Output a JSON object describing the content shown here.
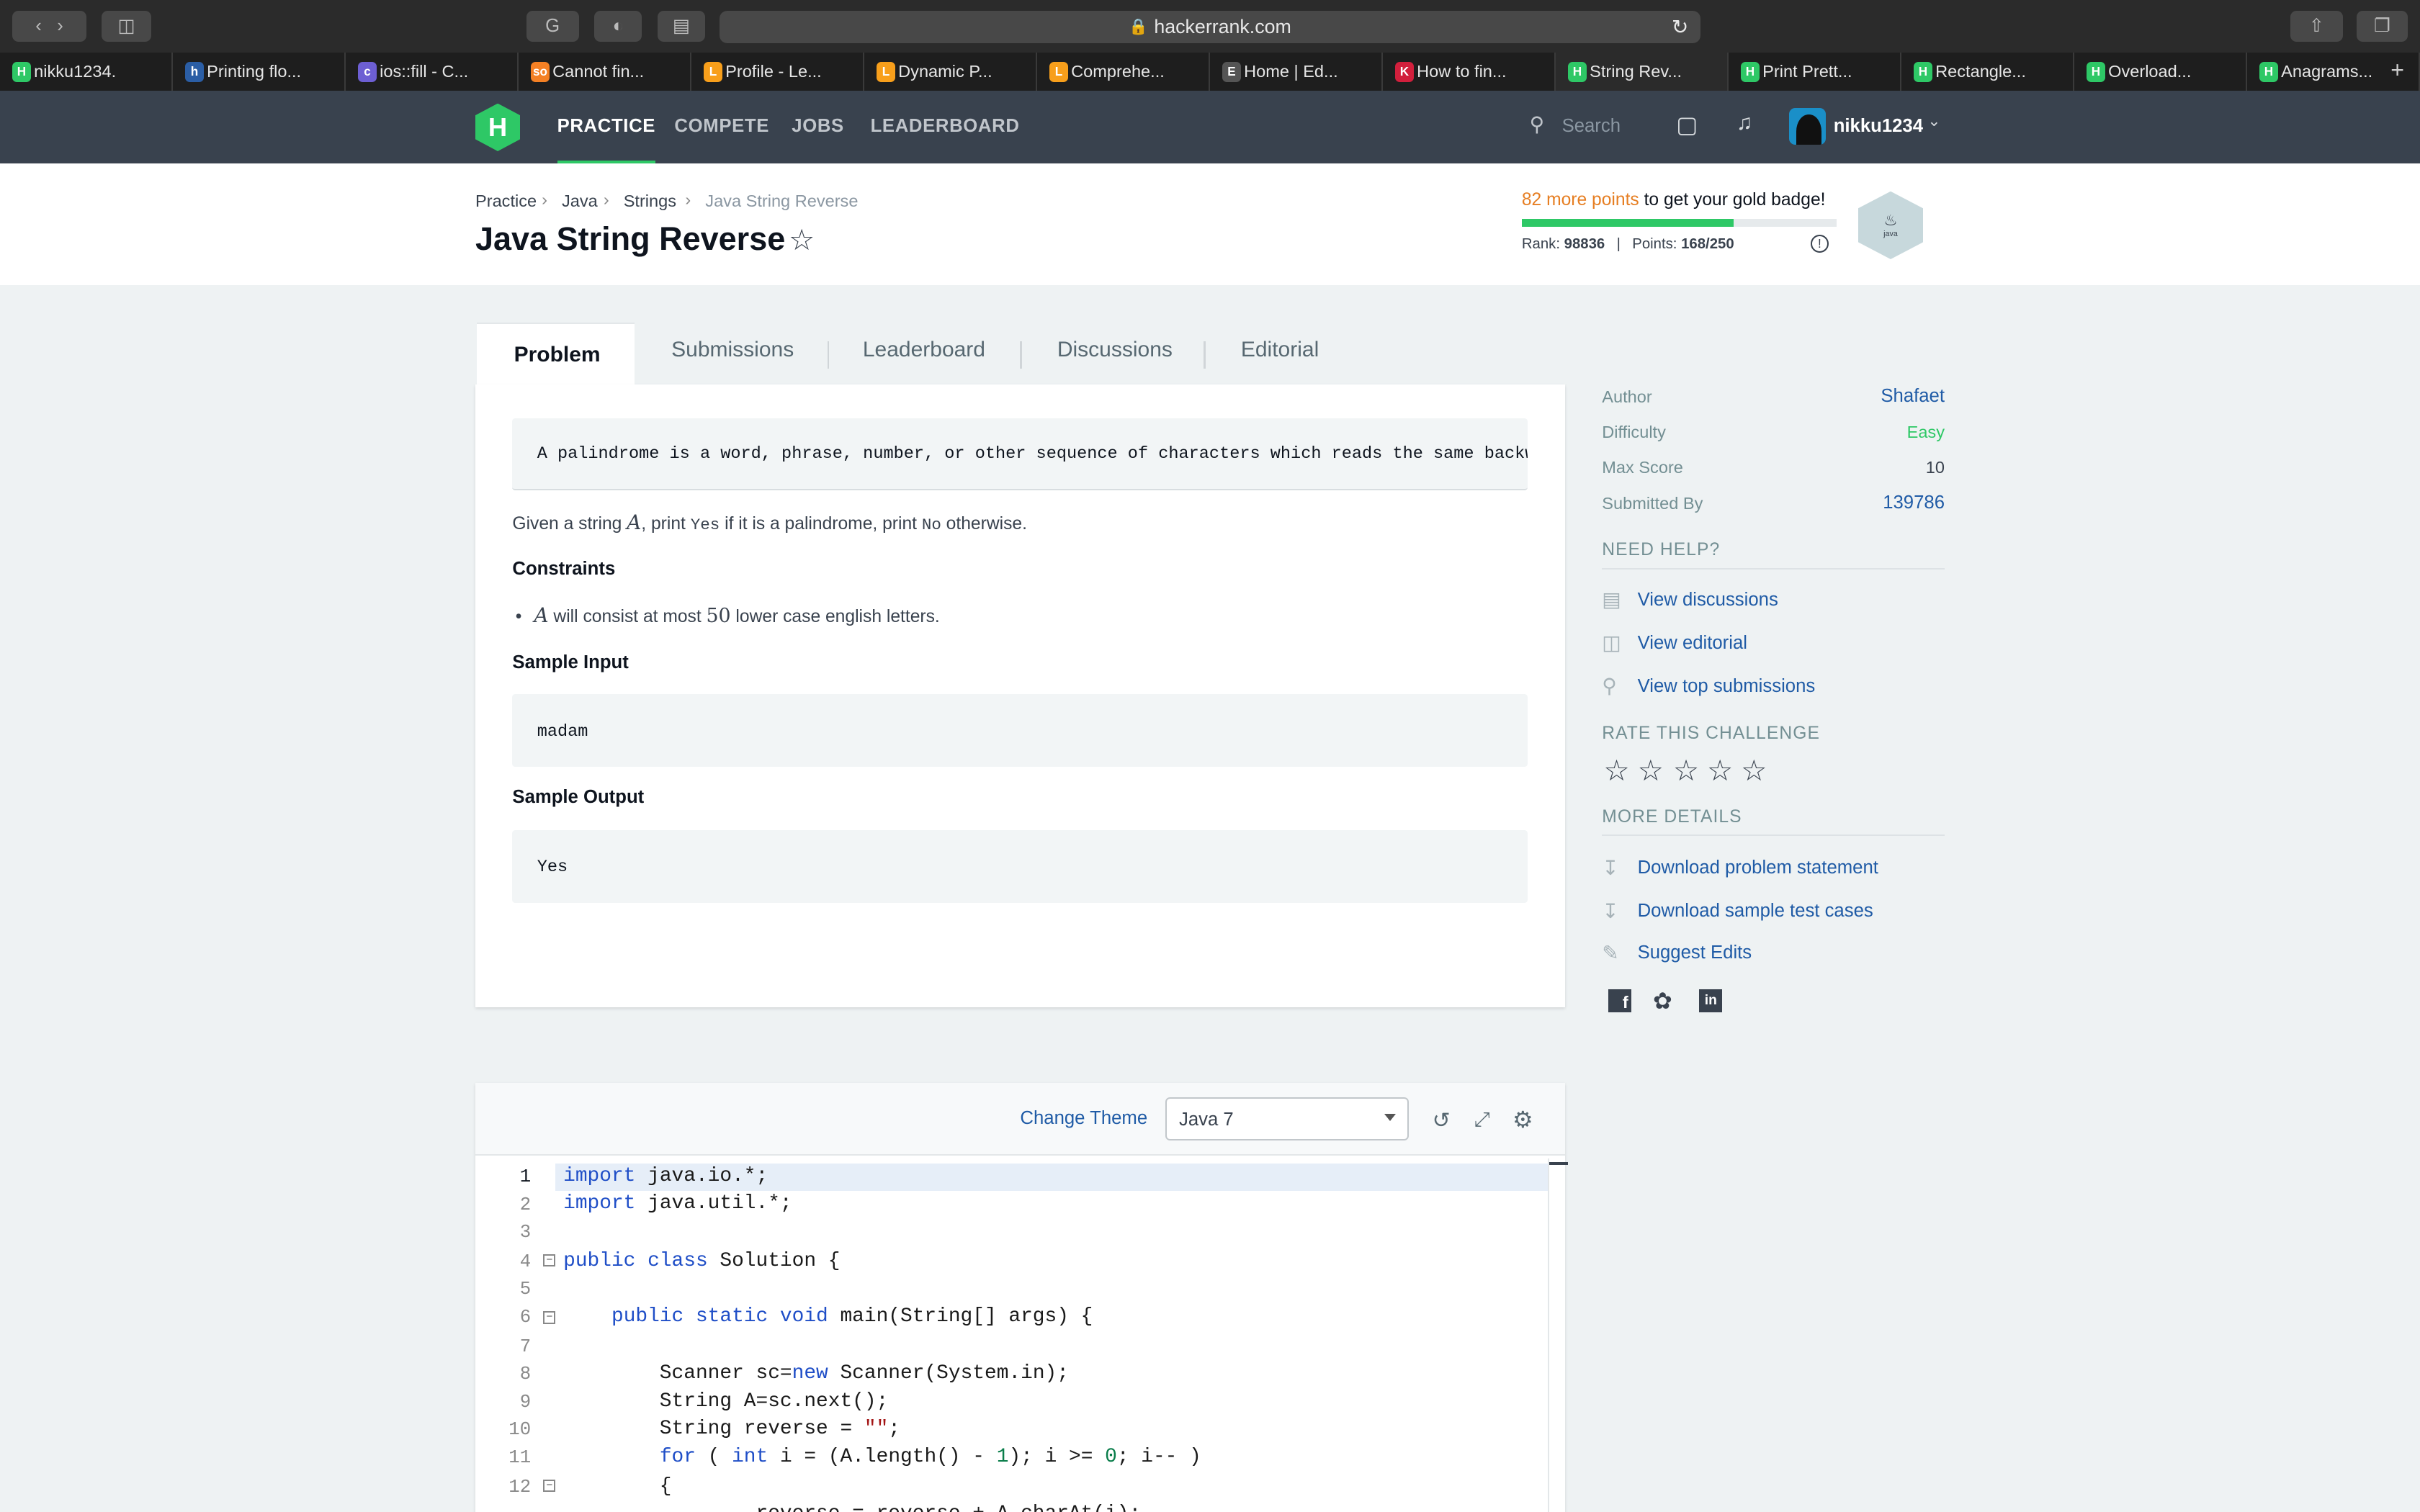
{
  "browser": {
    "url": "hackerrank.com",
    "tabs": [
      {
        "label": "nikku1234.",
        "favicon": "H",
        "color": "#2ec866"
      },
      {
        "label": "Printing flo...",
        "favicon": "h",
        "color": "#2b5ea5"
      },
      {
        "label": "ios::fill - C...",
        "favicon": "c",
        "color": "#6d5fd3"
      },
      {
        "label": "Cannot fin...",
        "favicon": "so",
        "color": "#f48024"
      },
      {
        "label": "Profile - Le...",
        "favicon": "L",
        "color": "#f89f1b"
      },
      {
        "label": "Dynamic P...",
        "favicon": "L",
        "color": "#f89f1b"
      },
      {
        "label": "Comprehe...",
        "favicon": "L",
        "color": "#f89f1b"
      },
      {
        "label": "Home | Ed...",
        "favicon": "E",
        "color": "#555555"
      },
      {
        "label": "How to fin...",
        "favicon": "K",
        "color": "#d21f3c"
      },
      {
        "label": "String Rev...",
        "favicon": "H",
        "color": "#2ec866",
        "active": true
      },
      {
        "label": "Print Prett...",
        "favicon": "H",
        "color": "#2ec866"
      },
      {
        "label": "Rectangle...",
        "favicon": "H",
        "color": "#2ec866"
      },
      {
        "label": "Overload...",
        "favicon": "H",
        "color": "#2ec866"
      },
      {
        "label": "Anagrams...",
        "favicon": "H",
        "color": "#2ec866"
      }
    ]
  },
  "nav": {
    "logo": "H",
    "links": [
      "PRACTICE",
      "COMPETE",
      "JOBS",
      "LEADERBOARD"
    ],
    "search_placeholder": "Search",
    "username": "nikku1234"
  },
  "breadcrumb": [
    "Practice",
    "Java",
    "Strings",
    "Java String Reverse"
  ],
  "page_title": "Java String Reverse",
  "badge": {
    "points_text": "82 more points",
    "suffix": " to get your gold badge!",
    "rank_label": "Rank:",
    "rank": "98836",
    "points_label": "Points:",
    "points": "168/250",
    "progress": 0.672,
    "badge_label": "java"
  },
  "problem_tabs": [
    "Problem",
    "Submissions",
    "Leaderboard",
    "Discussions",
    "Editorial"
  ],
  "problem": {
    "intro": "A palindrome is a word, phrase, number, or other sequence of characters which reads the same backwar",
    "given_1": "Given a string ",
    "var_a": "A",
    "given_2": ", print ",
    "yes": "Yes",
    "given_3": " if it is a palindrome, print ",
    "no": "No",
    "given_4": " otherwise.",
    "constraints_heading": "Constraints",
    "constraint_1": " will consist at most ",
    "constraint_num": "50",
    "constraint_2": " lower case english letters.",
    "sample_input_heading": "Sample Input",
    "sample_input": "madam",
    "sample_output_heading": "Sample Output",
    "sample_output": "Yes"
  },
  "sidebar": {
    "author_label": "Author",
    "author": "Shafaet",
    "difficulty_label": "Difficulty",
    "difficulty": "Easy",
    "max_score_label": "Max Score",
    "max_score": "10",
    "submitted_label": "Submitted By",
    "submitted": "139786",
    "need_help": "NEED HELP?",
    "help_links": [
      "View discussions",
      "View editorial",
      "View top submissions"
    ],
    "rate_heading": "RATE THIS CHALLENGE",
    "more_details": "MORE DETAILS",
    "detail_links": [
      "Download problem statement",
      "Download sample test cases",
      "Suggest Edits"
    ]
  },
  "editor": {
    "change_theme": "Change Theme",
    "language": "Java 7",
    "line_numbers": [
      "1",
      "2",
      "3",
      "4",
      "5",
      "6",
      "7",
      "8",
      "9",
      "10",
      "11",
      "12"
    ]
  },
  "colors": {
    "green": "#2ec866",
    "link": "#1f5ba6",
    "orange": "#e67e22",
    "nav": "#39424e"
  }
}
